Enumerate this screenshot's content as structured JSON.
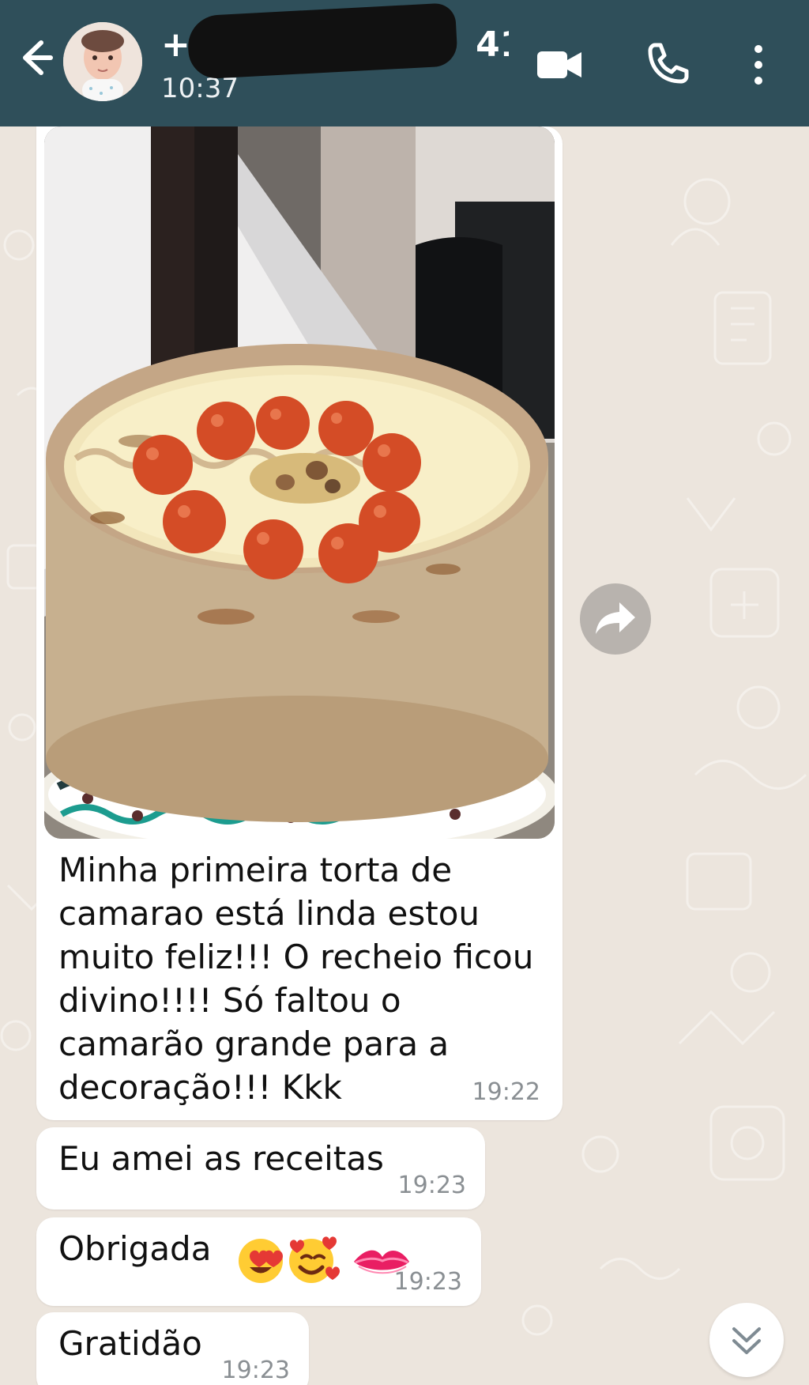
{
  "header": {
    "contact_name": "+5",
    "contact_name_tail": "41...",
    "status_time": "10:37",
    "avatar_alt": "profile-photo"
  },
  "messages": [
    {
      "kind": "photo",
      "caption": "Minha primeira torta de camarao está linda estou muito feliz!!! O recheio ficou divino!!!! Só faltou o camarão grande para a decoração!!! Kkk",
      "time": "19:22"
    },
    {
      "kind": "text",
      "text": "Eu amei as receitas",
      "time": "19:23"
    },
    {
      "kind": "text",
      "text": "Obrigada",
      "emoji": [
        "smiling-face-with-heart-eyes",
        "smiling-face-with-hearts",
        "kiss-mark"
      ],
      "time": "19:23"
    },
    {
      "kind": "text",
      "text": "Gratidão",
      "time": "19:23"
    }
  ],
  "icons": {
    "back": "back-arrow-icon",
    "video": "video-call-icon",
    "phone": "phone-icon",
    "menu": "more-vertical-icon",
    "forward": "forward-icon",
    "scroll": "double-chevron-down-icon"
  },
  "colors": {
    "header": "#2f4f5a",
    "chat_background": "#ece5dd",
    "bubble": "#ffffff",
    "time": "#8a8f93"
  }
}
